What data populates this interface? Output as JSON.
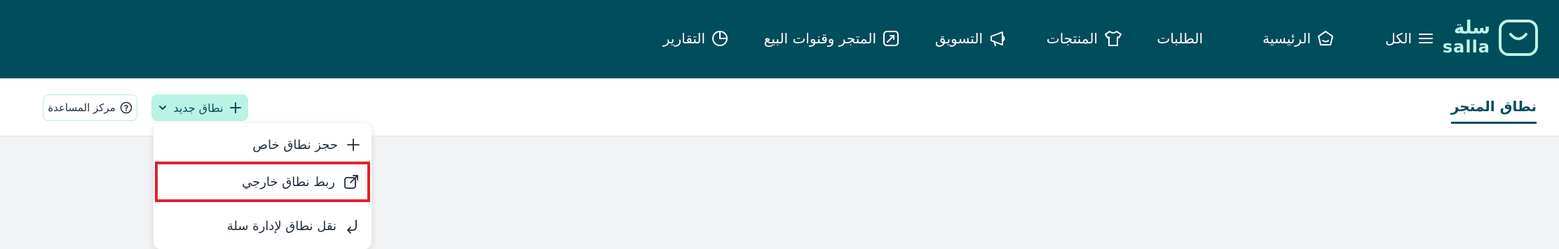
{
  "brand": {
    "name_ar": "سلة",
    "name_en": "salla",
    "accent": "#bdf5e6",
    "nav_bg": "#004d5b"
  },
  "nav": {
    "all": "الكل",
    "home": "الرئيسية",
    "orders": "الطلبات",
    "products": "المنتجات",
    "marketing": "التسويق",
    "store_channels": "المتجر وقنوات البيع",
    "reports": "التقارير"
  },
  "page": {
    "title": "نطاق المتجر"
  },
  "actions": {
    "new_domain": "نطاق جديد",
    "help_center": "مركز المساعدة"
  },
  "dropdown": {
    "items": [
      {
        "label": "حجز نطاق خاص",
        "icon": "plus-icon"
      },
      {
        "label": "ربط نطاق خارجي",
        "icon": "external-link-icon",
        "highlighted": true
      },
      {
        "label": "نقل نطاق لإدارة سلة",
        "icon": "transfer-arrow-icon"
      }
    ],
    "highlight_color": "#e0222d"
  }
}
